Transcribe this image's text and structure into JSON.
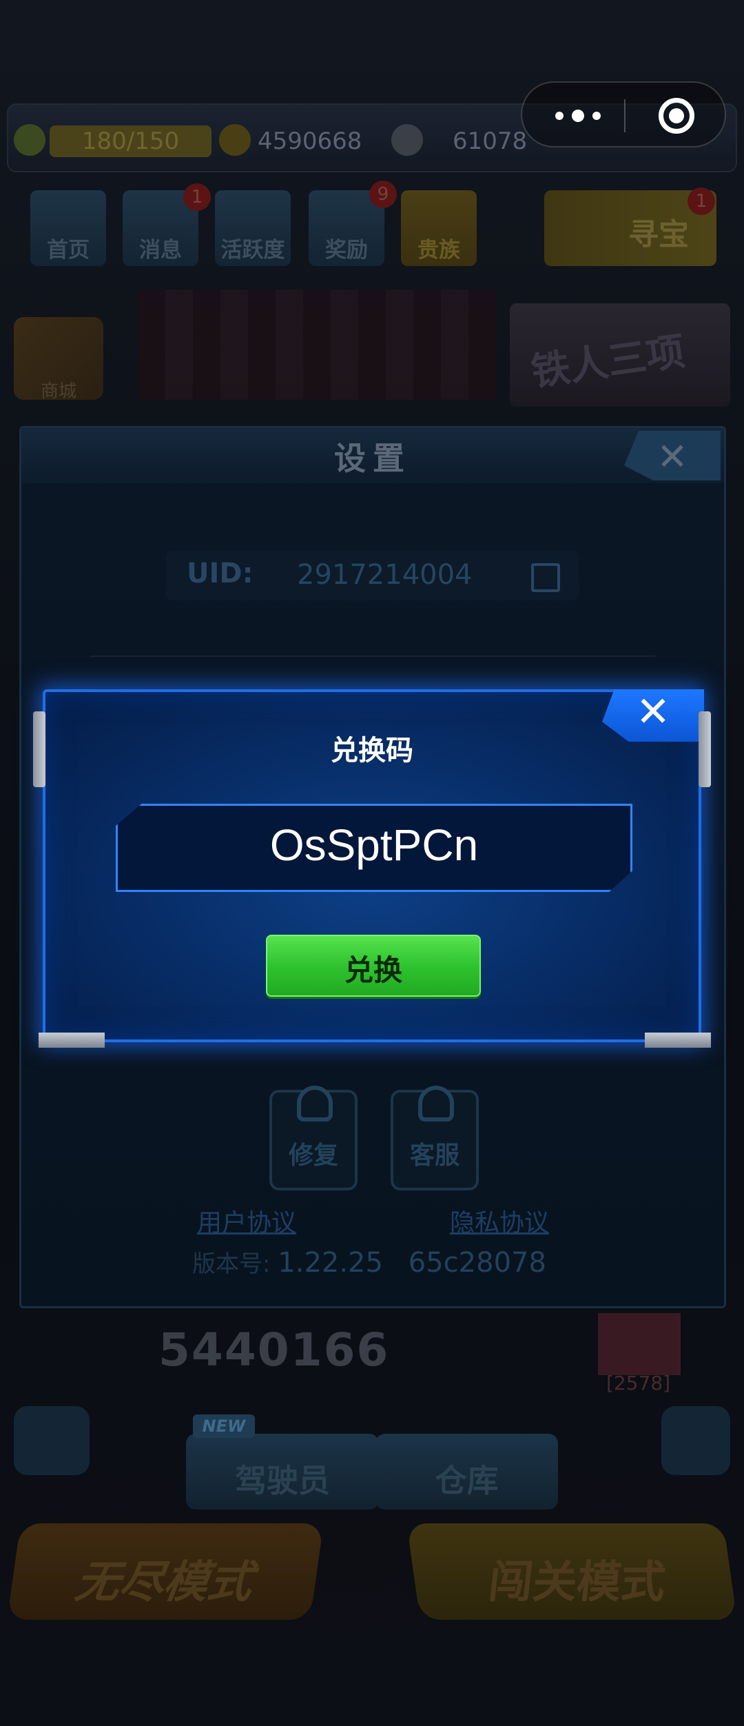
{
  "hud": {
    "energy": "180/150",
    "coins": "4590668",
    "gems": "61078"
  },
  "top_menu": [
    {
      "label": "首页",
      "badge": ""
    },
    {
      "label": "消息",
      "badge": "1"
    },
    {
      "label": "活跃度",
      "badge": ""
    },
    {
      "label": "奖励",
      "badge": "9"
    },
    {
      "label": "贵族",
      "badge": ""
    }
  ],
  "seek_treasure": {
    "label": "寻宝",
    "badge": "1"
  },
  "shop_label": "商城",
  "promo_text": "铁人三项",
  "settings": {
    "title": "设置",
    "close": "✕",
    "uid_label": "UID:",
    "uid_value": "2917214004",
    "repair_label": "修复",
    "service_label": "客服",
    "user_agreement": "用户协议",
    "privacy_policy": "隐私协议",
    "version_label": "版本号:",
    "version_number": "1.22.25",
    "version_hash": "65c28078"
  },
  "redeem_dialog": {
    "title": "兑换码",
    "close": "✕",
    "code_value": "OsSptPCn",
    "redeem_button": "兑换"
  },
  "bottom": {
    "score": "5440166",
    "rank": "[2578]",
    "new_tag": "NEW",
    "pilot_label": "驾驶员",
    "warehouse_label": "仓库",
    "endless_mode": "无尽模式",
    "stage_mode": "闯关模式"
  },
  "colors": {
    "dialog_border": "#1e6fe6",
    "redeem_button": "#2fc42f",
    "accent_blue": "#1d78ff"
  }
}
